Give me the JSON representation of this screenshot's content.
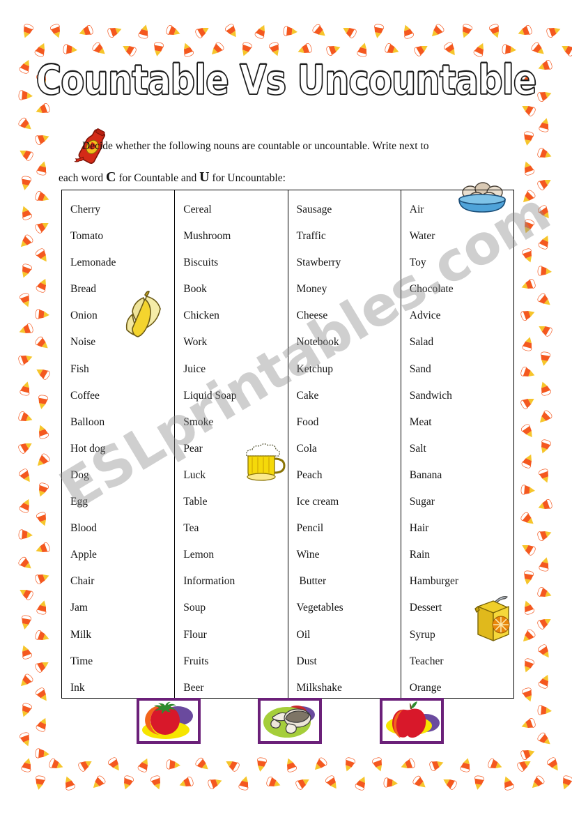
{
  "page": {
    "title": "Countable Vs Uncountable",
    "watermark": "ESLprintables.com",
    "border_icon": "candy-corn-icon",
    "colors": {
      "candy_orange": "#F4581F",
      "candy_yellow": "#F6C52B",
      "candy_white": "#FFFFFF",
      "frame_purple": "#6B2079",
      "table_border": "#000000",
      "text": "#141414",
      "watermark": "#8C8C8C"
    }
  },
  "instructions": {
    "line1": "Decide whether the following nouns are countable or uncountable. Write next to",
    "line2_before": "each word ",
    "line2_c": "C",
    "line2_mid": " for Countable and ",
    "line2_u": "U",
    "line2_after": " for Uncountable:"
  },
  "table": {
    "columns": [
      {
        "name": "column-1",
        "words": [
          "Cherry",
          "Tomato",
          "Lemonade",
          "Bread",
          "Onion",
          "Noise",
          "Fish",
          "Coffee",
          "Balloon",
          "Hot dog",
          "Dog",
          "Egg",
          "Blood",
          "Apple",
          "Chair",
          "Jam",
          "Milk",
          "Time",
          "Ink"
        ]
      },
      {
        "name": "column-2",
        "words": [
          "Cereal",
          "Mushroom",
          "Biscuits",
          "Book",
          "Chicken",
          "Work",
          "Juice",
          "Liquid Soap",
          "Smoke",
          "Pear",
          "Luck",
          "Table",
          "Tea",
          "Lemon",
          "Information",
          "Soup",
          "Flour",
          "Fruits",
          "Beer"
        ]
      },
      {
        "name": "column-3",
        "words": [
          "Sausage",
          "Traffic",
          "Stawberry",
          "Money",
          "Cheese",
          "Notebook",
          "Ketchup",
          "Cake",
          "Food",
          "Cola",
          "Peach",
          "Ice cream",
          "Pencil",
          "Wine",
          " Butter",
          "Vegetables",
          "Oil",
          "Dust",
          "Milkshake"
        ]
      },
      {
        "name": "column-4",
        "words": [
          "Air",
          "Water",
          "Toy",
          "Chocolate",
          "Advice",
          "Salad",
          "Sand",
          "Sandwich",
          "Meat",
          "Salt",
          "Banana",
          "Sugar",
          "Hair",
          "Rain",
          "Hamburger",
          "Dessert",
          "Syrup",
          "Teacher",
          "Orange"
        ]
      }
    ]
  },
  "clipart": [
    {
      "name": "ketchup-bottle-icon"
    },
    {
      "name": "egg-bowl-icon"
    },
    {
      "name": "banana-icon"
    },
    {
      "name": "beer-mug-icon"
    },
    {
      "name": "juice-box-icon"
    }
  ],
  "bottom_pictures": [
    {
      "name": "tomato-picture"
    },
    {
      "name": "mushroom-picture"
    },
    {
      "name": "apple-picture"
    }
  ]
}
